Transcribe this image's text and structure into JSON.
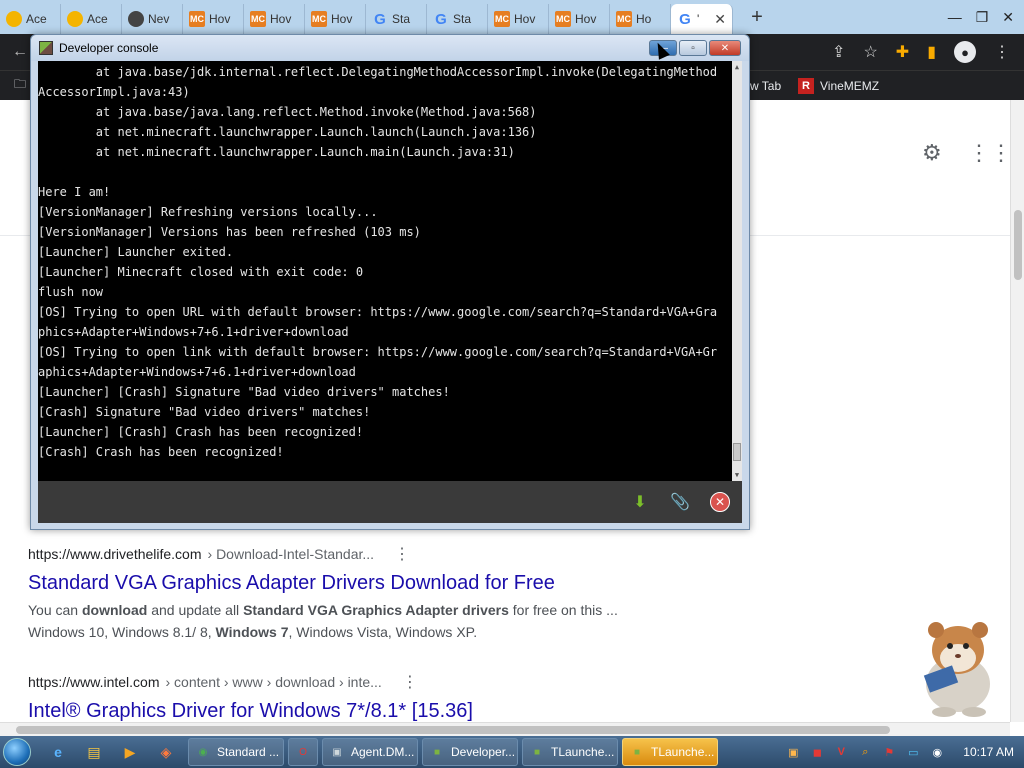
{
  "browser": {
    "tabs": [
      {
        "label": "Ace",
        "icon": "ace-icon"
      },
      {
        "label": "Ace",
        "icon": "ace-icon"
      },
      {
        "label": "Nev",
        "icon": "circle-icon"
      },
      {
        "label": "Hov",
        "icon": "mc-icon"
      },
      {
        "label": "Hov",
        "icon": "mc-icon"
      },
      {
        "label": "Hov",
        "icon": "mc-icon"
      },
      {
        "label": "Sta",
        "icon": "google-icon"
      },
      {
        "label": "Sta",
        "icon": "google-icon"
      },
      {
        "label": "Hov",
        "icon": "mc-icon"
      },
      {
        "label": "Hov",
        "icon": "mc-icon"
      },
      {
        "label": "Ho",
        "icon": "mc-icon"
      }
    ],
    "active_tab": {
      "label": "' ",
      "icon": "google-icon"
    },
    "new_tab": "+",
    "bookmarks": [
      {
        "label": "w Tab"
      },
      {
        "label": "VineMEMZ",
        "badge": "R"
      }
    ]
  },
  "results": [
    {
      "site": "https://www.drivethelife.com",
      "crumb": "› Download-Intel-Standar...",
      "title": "Standard VGA Graphics Adapter Drivers Download for Free",
      "snippet_parts": [
        "You can ",
        "download",
        " and update all ",
        "Standard VGA Graphics Adapter drivers",
        " for free on this ..."
      ],
      "snippet2_parts": [
        "Windows 10, Windows 8.1/ 8, ",
        "Windows 7",
        ", Windows Vista, Windows XP."
      ]
    },
    {
      "site": "https://www.intel.com",
      "crumb": "› content › www › download › inte...",
      "title": "Intel® Graphics Driver for Windows 7*/8.1* [15.36]"
    }
  ],
  "devconsole": {
    "title": "Developer console",
    "lines": [
      "        at java.base/jdk.internal.reflect.DelegatingMethodAccessorImpl.invoke(DelegatingMethodAccessorImpl.java:43)",
      "        at java.base/java.lang.reflect.Method.invoke(Method.java:568)",
      "        at net.minecraft.launchwrapper.Launch.launch(Launch.java:136)",
      "        at net.minecraft.launchwrapper.Launch.main(Launch.java:31)",
      "",
      "Here I am!",
      "[VersionManager] Refreshing versions locally...",
      "[VersionManager] Versions has been refreshed (103 ms)",
      "[Launcher] Launcher exited.",
      "[Launcher] Minecraft closed with exit code: 0",
      "flush now",
      "[OS] Trying to open URL with default browser: https://www.google.com/search?q=Standard+VGA+Graphics+Adapter+Windows+7+6.1+driver+download",
      "[OS] Trying to open link with default browser: https://www.google.com/search?q=Standard+VGA+Graphics+Adapter+Windows+7+6.1+driver+download",
      "[Launcher] [Crash] Signature \"Bad video drivers\" matches!",
      "[Crash] Signature \"Bad video drivers\" matches!",
      "[Launcher] [Crash] Crash has been recognized!",
      "[Crash] Crash has been recognized!"
    ]
  },
  "taskbar": {
    "tasks": [
      {
        "label": "Standard ...",
        "icon": "chrome-icon"
      },
      {
        "label": "",
        "icon": "opera-icon"
      },
      {
        "label": "Agent.DM...",
        "icon": "window-icon"
      },
      {
        "label": "Developer...",
        "icon": "cube-icon"
      },
      {
        "label": "TLaunche...",
        "icon": "cube-icon"
      },
      {
        "label": "TLaunche...",
        "icon": "cube-icon",
        "active": true
      }
    ],
    "clock": "10:17 AM"
  },
  "colors": {
    "link": "#1a0dab",
    "console_bg": "#000000",
    "taskbar": "#2c4a6a"
  }
}
